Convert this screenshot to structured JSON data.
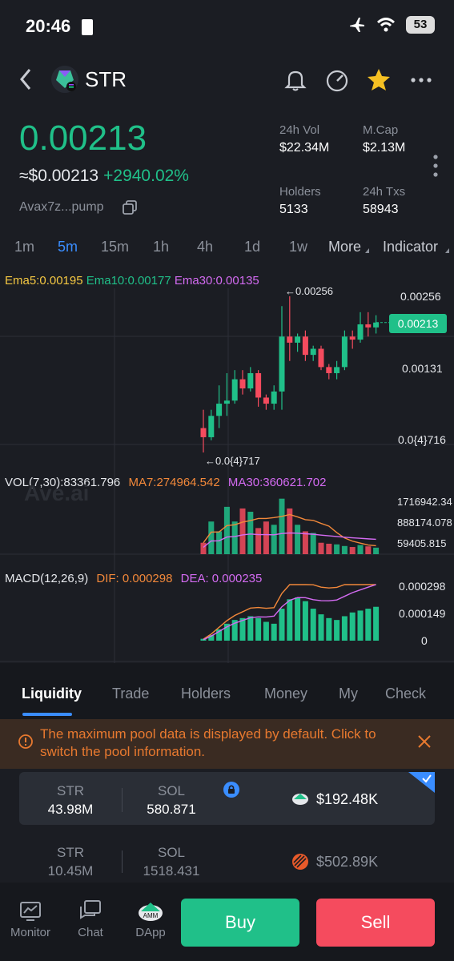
{
  "status": {
    "time": "20:46",
    "battery": "53"
  },
  "header": {
    "token": "STR"
  },
  "price": {
    "value": "0.00213",
    "usd": "≈$0.00213",
    "change": "+2940.02%",
    "address": "Avax7z...pump"
  },
  "stats": {
    "vol_label": "24h Vol",
    "vol_value": "$22.34M",
    "mcap_label": "M.Cap",
    "mcap_value": "$2.13M",
    "holders_label": "Holders",
    "holders_value": "5133",
    "txs_label": "24h Txs",
    "txs_value": "58943"
  },
  "timeframes": [
    "1m",
    "5m",
    "15m",
    "1h",
    "4h",
    "1d",
    "1w",
    "More",
    "Indicator"
  ],
  "active_timeframe": "5m",
  "indicators": {
    "ema5": "Ema5:0.00195",
    "ema10": "Ema10:0.00177",
    "ema30": "Ema30:0.00135",
    "vol": "VOL(7,30):83361.796",
    "ma7": "MA7:274964.542",
    "ma30": "MA30:360621.702",
    "macd": "MACD(12,26,9)",
    "dif": "DIF: 0.000298",
    "dea": "DEA: 0.000235"
  },
  "price_axis": {
    "high": "0.00256",
    "current": "0.00213",
    "mid": "0.00131",
    "low": "0.0{4}716"
  },
  "annotations": {
    "max": "←0.00256",
    "min": "←0.0{4}717"
  },
  "vol_axis": {
    "top": "1716942.34",
    "mid": "888174.078",
    "low": "59405.815"
  },
  "macd_axis": {
    "top": "0.000298",
    "mid": "0.000149",
    "zero": "0"
  },
  "watermark": "Ave.ai",
  "colors": {
    "up": "#20c089",
    "down": "#f54b5e",
    "accent": "#3a8dff",
    "ema5": "#f5c842",
    "ema10": "#20c089",
    "ema30": "#d46bf2",
    "ma7": "#f2883a"
  },
  "chart_data": {
    "type": "candlestick",
    "ohlc": [
      [
        0.0004,
        0.00025,
        0.0,
        0.0007
      ],
      [
        0.00025,
        0.0006,
        0.0002,
        0.0007
      ],
      [
        0.0006,
        0.0008,
        0.0004,
        0.0011
      ],
      [
        0.0008,
        0.00085,
        0.0006,
        0.0013
      ],
      [
        0.00085,
        0.0012,
        0.0008,
        0.00135
      ],
      [
        0.0012,
        0.00105,
        0.00095,
        0.00135
      ],
      [
        0.00105,
        0.0013,
        0.001,
        0.0014
      ],
      [
        0.0013,
        0.0009,
        0.00075,
        0.00135
      ],
      [
        0.0009,
        0.0008,
        0.0007,
        0.00095
      ],
      [
        0.0008,
        0.001,
        0.0007,
        0.0011
      ],
      [
        0.001,
        0.0019,
        0.0007,
        0.0024
      ],
      [
        0.0019,
        0.0018,
        0.0015,
        0.00256
      ],
      [
        0.0018,
        0.0019,
        0.00165,
        0.00195
      ],
      [
        0.0019,
        0.0016,
        0.0015,
        0.002
      ],
      [
        0.0016,
        0.0017,
        0.0015,
        0.00175
      ],
      [
        0.0017,
        0.0014,
        0.00135,
        0.00175
      ],
      [
        0.0014,
        0.0013,
        0.0012,
        0.00145
      ],
      [
        0.0013,
        0.0014,
        0.0012,
        0.0015
      ],
      [
        0.0014,
        0.0019,
        0.00135,
        0.002
      ],
      [
        0.0019,
        0.00185,
        0.0017,
        0.002
      ],
      [
        0.00185,
        0.0021,
        0.0018,
        0.0023
      ],
      [
        0.0021,
        0.00205,
        0.0019,
        0.0023
      ],
      [
        0.00205,
        0.00213,
        0.00195,
        0.00225
      ]
    ],
    "volume": [
      350000,
      1000000,
      700000,
      1450000,
      1000000,
      1400000,
      1300000,
      800000,
      1000000,
      900000,
      1700000,
      1400000,
      900000,
      700000,
      650000,
      350000,
      320000,
      300000,
      250000,
      220000,
      280000,
      240000,
      200000
    ],
    "macd_hist": [
      1e-05,
      3e-05,
      6e-05,
      9e-05,
      0.00011,
      0.00012,
      0.00013,
      0.00012,
      0.0001,
      9e-05,
      0.00017,
      0.00022,
      0.00023,
      0.00021,
      0.00017,
      0.00014,
      0.00012,
      0.00011,
      0.00013,
      0.00015,
      0.00016,
      0.00017,
      0.00018
    ]
  },
  "tabs": [
    "Liquidity",
    "Trade",
    "Holders",
    "Money",
    "My",
    "Check"
  ],
  "notice": "The maximum pool data is displayed by default. Click to switch the pool information.",
  "pools": [
    {
      "sym1": "STR",
      "val1": "43.98M",
      "sym2": "SOL",
      "val2": "580.871",
      "usd": "$192.48K"
    },
    {
      "sym1": "STR",
      "val1": "10.45M",
      "sym2": "SOL",
      "val2": "1518.431",
      "usd": "$502.89K"
    }
  ],
  "bottom_nav": {
    "monitor": "Monitor",
    "chat": "Chat",
    "dapp": "DApp",
    "buy": "Buy",
    "sell": "Sell"
  }
}
